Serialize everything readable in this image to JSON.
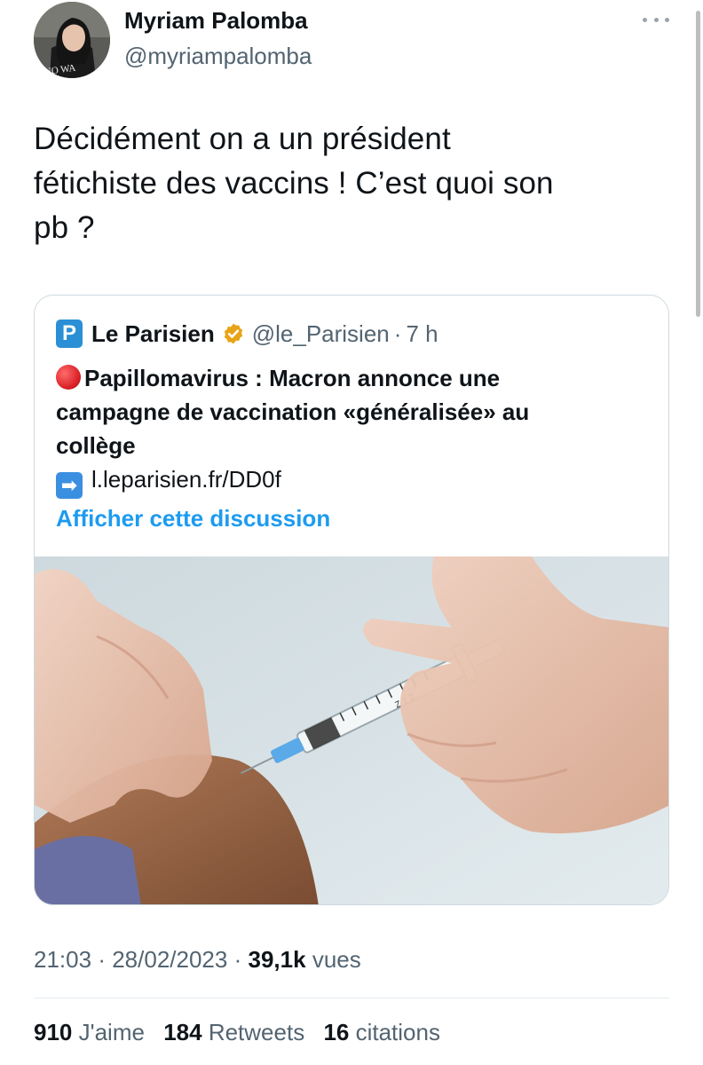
{
  "author": {
    "name": "Myriam Palomba",
    "handle": "@myriampalomba",
    "avatar_shirt_text": "NO WA"
  },
  "more_icon": "ellipsis-icon",
  "tweet": {
    "lines": [
      "Décidément on a un président",
      "fétichiste des vaccins ! C’est quoi son",
      "pb ?"
    ]
  },
  "quote": {
    "logo_letter": "P",
    "name": "Le Parisien",
    "verified_icon": "verified-badge-icon",
    "handle": "@le_Parisien",
    "separator": "·",
    "time": "7 h",
    "line1": "Papillomavirus : Macron annonce une",
    "line2": "campagne de vaccination «généralisée» au",
    "line3": "collège",
    "link": "l.leparisien.fr/DD0f",
    "show_thread": "Afficher cette discussion",
    "syringe_marks": "Z 1 Z"
  },
  "meta": {
    "time": "21:03",
    "sep1": "·",
    "date": "28/02/2023",
    "sep2": "·",
    "views_count": "39,1k",
    "views_label": "vues"
  },
  "stats": {
    "likes_count": "910",
    "likes_label": "J'aime",
    "retweets_count": "184",
    "retweets_label": "Retweets",
    "quotes_count": "16",
    "quotes_label": "citations"
  },
  "colors": {
    "accent": "#1d9bf0",
    "text": "#0f1419",
    "muted": "#536471",
    "verified": "#e8a317",
    "brand": "#2b8fd6"
  }
}
